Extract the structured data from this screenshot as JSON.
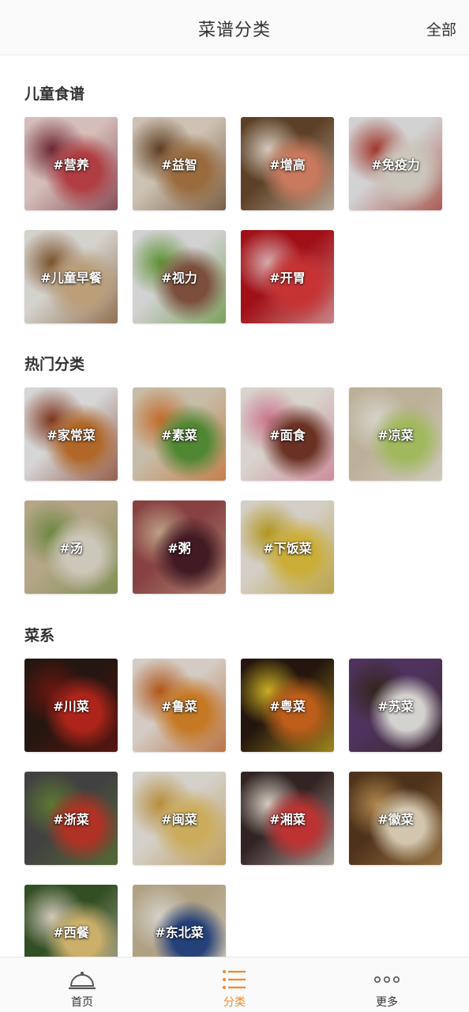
{
  "header": {
    "title": "菜谱分类",
    "all_label": "全部"
  },
  "sections": [
    {
      "title": "儿童食谱",
      "items": [
        {
          "label": "#营养",
          "colors": [
            "#f3d9d4",
            "#c8464b",
            "#7a2a3a"
          ]
        },
        {
          "label": "#益智",
          "colors": [
            "#e9dccb",
            "#b07a45",
            "#6b4524"
          ]
        },
        {
          "label": "#增高",
          "colors": [
            "#6a4a2c",
            "#e58a6a",
            "#f4e6d8"
          ]
        },
        {
          "label": "#免疫力",
          "colors": [
            "#f0f0f0",
            "#e8e2d6",
            "#b53a2e"
          ]
        },
        {
          "label": "#儿童早餐",
          "colors": [
            "#f2efe9",
            "#d5b58a",
            "#8a5a2e"
          ]
        },
        {
          "label": "#视力",
          "colors": [
            "#efefef",
            "#8c5a44",
            "#6aa53a"
          ]
        },
        {
          "label": "#开胃",
          "colors": [
            "#b8131b",
            "#e33b3b",
            "#f5c6c6"
          ]
        }
      ]
    },
    {
      "title": "热门分类",
      "items": [
        {
          "label": "#家常菜",
          "colors": [
            "#f4f4f4",
            "#c9762f",
            "#8e3a1e"
          ]
        },
        {
          "label": "#素菜",
          "colors": [
            "#e3d6bf",
            "#5c9a3a",
            "#e07a30"
          ]
        },
        {
          "label": "#面食",
          "colors": [
            "#f7f1ea",
            "#7a3a2a",
            "#e6849d"
          ]
        },
        {
          "label": "#凉菜",
          "colors": [
            "#d7c9ad",
            "#b7d36a",
            "#f3f1e8"
          ]
        },
        {
          "label": "#汤",
          "colors": [
            "#cfbe9c",
            "#e9e3d3",
            "#7c9a4a"
          ]
        },
        {
          "label": "#粥",
          "colors": [
            "#9a4a4a",
            "#4a1e2a",
            "#d9b89a"
          ]
        },
        {
          "label": "#下饭菜",
          "colors": [
            "#f2ece2",
            "#e8c640",
            "#c9a820"
          ]
        }
      ]
    },
    {
      "title": "菜系",
      "items": [
        {
          "label": "#川菜",
          "colors": [
            "#2a1a14",
            "#c82a1e",
            "#7a1a12"
          ]
        },
        {
          "label": "#鲁菜",
          "colors": [
            "#f2e8e0",
            "#e28a2a",
            "#c8601a"
          ]
        },
        {
          "label": "#粤菜",
          "colors": [
            "#2a1a10",
            "#d66a1e",
            "#e8c82a"
          ]
        },
        {
          "label": "#苏菜",
          "colors": [
            "#5a3a6a",
            "#f2f0ec",
            "#3a2a1e"
          ]
        },
        {
          "label": "#浙菜",
          "colors": [
            "#4a4a4a",
            "#c83a2a",
            "#6a8a3a"
          ]
        },
        {
          "label": "#闽菜",
          "colors": [
            "#f2eee6",
            "#e8c46a",
            "#d0a040"
          ]
        },
        {
          "label": "#湘菜",
          "colors": [
            "#3a2a2a",
            "#d83a3a",
            "#f2eadc"
          ]
        },
        {
          "label": "#徽菜",
          "colors": [
            "#5a3a1e",
            "#f0e2c6",
            "#c89a5a"
          ]
        },
        {
          "label": "#西餐",
          "colors": [
            "#3a5a2a",
            "#e8c87a",
            "#f0e6d6"
          ]
        },
        {
          "label": "#东北菜",
          "colors": [
            "#c9b896",
            "#2a4a8a",
            "#f2efe6"
          ]
        }
      ]
    }
  ],
  "tabbar": {
    "items": [
      {
        "label": "首页",
        "icon": "cloche-icon"
      },
      {
        "label": "分类",
        "icon": "list-icon",
        "active": true
      },
      {
        "label": "更多",
        "icon": "more-dots-icon"
      }
    ],
    "active_color": "#f08a2c"
  }
}
